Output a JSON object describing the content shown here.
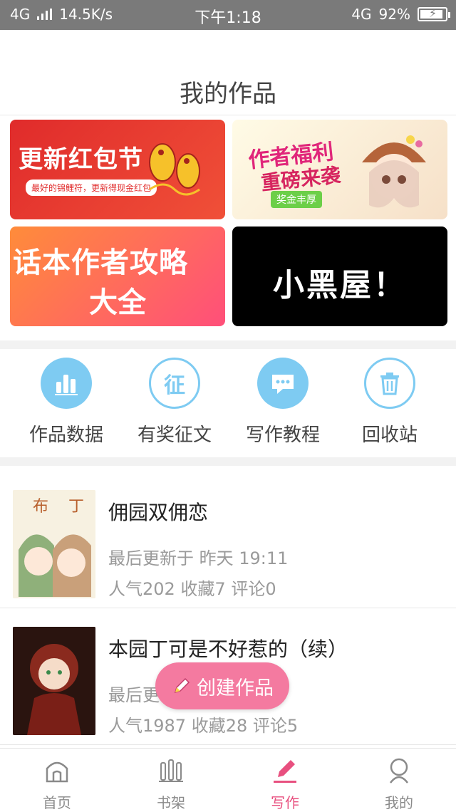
{
  "status_bar": {
    "network_left": "4G",
    "speed": "14.5K/s",
    "time": "下午1:18",
    "network_right": "4G",
    "battery": "92%",
    "battery_level": 0.92
  },
  "header": {
    "title": "我的作品"
  },
  "banners": [
    {
      "name": "red-packet",
      "title": "更新红包节",
      "subtitle": "最好的锦鲤符，更新得现金红包"
    },
    {
      "name": "author-benefits",
      "line1": "作者福利",
      "line2": "重磅来袭",
      "tag": "奖金丰厚"
    },
    {
      "name": "author-guide",
      "line1": "话本作者攻略",
      "line2": "大全"
    },
    {
      "name": "black-room",
      "title": "小黑屋！"
    }
  ],
  "tools": [
    {
      "label": "作品数据",
      "icon": "bar-chart-icon"
    },
    {
      "label": "有奖征文",
      "icon": "contest-icon",
      "glyph": "征"
    },
    {
      "label": "写作教程",
      "icon": "chat-icon"
    },
    {
      "label": "回收站",
      "icon": "trash-icon"
    }
  ],
  "works": [
    {
      "title": "佣园双佣恋",
      "updated": "最后更新于 昨天 19:11",
      "stats": "人气202 收藏7 评论0"
    },
    {
      "title": "本园丁可是不好惹的（续）",
      "updated": "最后更新于 昨天 19:27",
      "stats": "人气1987 收藏28 评论5"
    }
  ],
  "fab": {
    "label": "创建作品"
  },
  "tabbar": [
    {
      "label": "首页",
      "icon": "home-icon"
    },
    {
      "label": "书架",
      "icon": "bookshelf-icon"
    },
    {
      "label": "写作",
      "icon": "pen-icon",
      "active": true
    },
    {
      "label": "我的",
      "icon": "profile-icon"
    }
  ],
  "colors": {
    "accent": "#e8507f",
    "tool_circle": "#7ecbf2",
    "fab": "#f47aa0"
  }
}
